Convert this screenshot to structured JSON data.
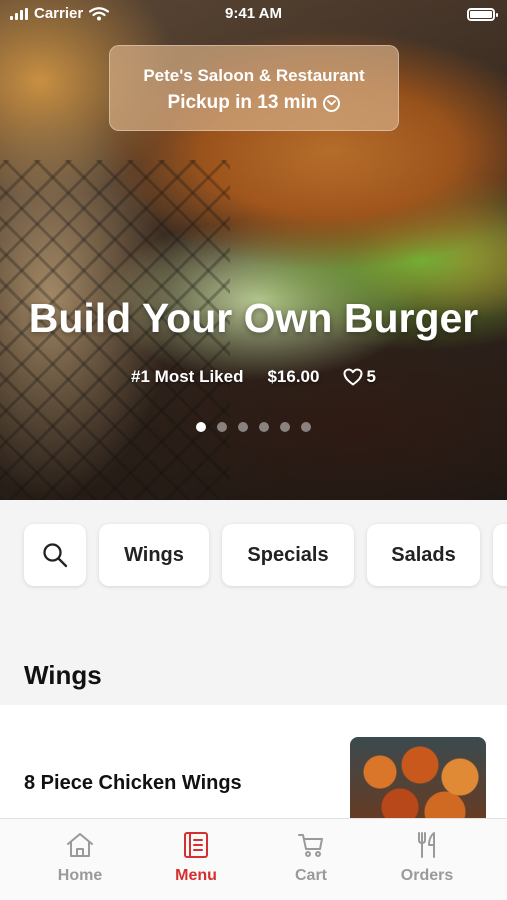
{
  "status_bar": {
    "carrier": "Carrier",
    "time": "9:41 AM"
  },
  "pickup": {
    "restaurant": "Pete's Saloon & Restaurant",
    "eta": "Pickup in 13 min"
  },
  "hero": {
    "title": "Build Your Own Burger",
    "badge": "#1 Most Liked",
    "price": "$16.00",
    "likes": "5",
    "carousel_pages": 6,
    "carousel_active": 1
  },
  "categories": {
    "items": [
      "Wings",
      "Specials",
      "Salads"
    ]
  },
  "section": {
    "title": "Wings"
  },
  "menu_items": [
    {
      "name": "8 Piece Chicken Wings"
    }
  ],
  "tabbar": {
    "tabs": [
      {
        "label": "Home",
        "icon": "home-icon"
      },
      {
        "label": "Menu",
        "icon": "menu-icon"
      },
      {
        "label": "Cart",
        "icon": "cart-icon"
      },
      {
        "label": "Orders",
        "icon": "fork-knife-icon"
      }
    ],
    "active": "Menu",
    "active_color": "#d62f2f"
  }
}
